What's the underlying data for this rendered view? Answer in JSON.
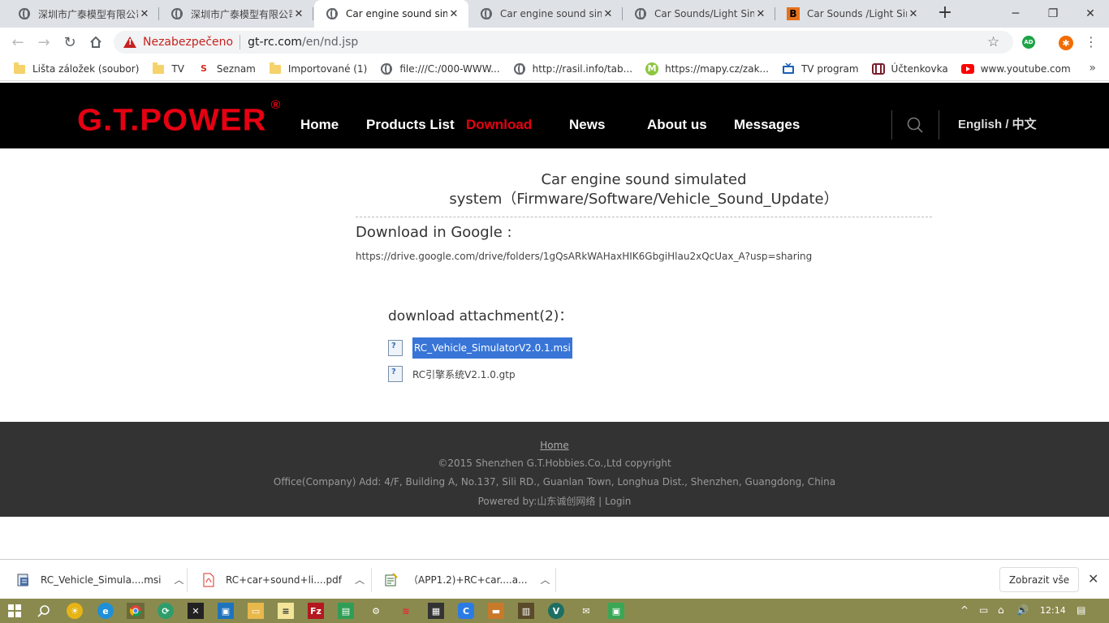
{
  "browser": {
    "tabs": [
      {
        "title": "深圳市广泰模型有限公司",
        "favicon": "globe-icon",
        "active": false
      },
      {
        "title": "深圳市广泰模型有限公司",
        "favicon": "globe-icon",
        "active": false
      },
      {
        "title": "Car engine sound simulated",
        "favicon": "globe-icon",
        "active": true
      },
      {
        "title": "Car engine sound simulated",
        "favicon": "globe-icon",
        "active": false
      },
      {
        "title": "Car Sounds/Light Simulator",
        "favicon": "globe-icon",
        "active": false
      },
      {
        "title": "Car Sounds /Light Simulator",
        "favicon": "b-icon",
        "favicon_text": "B",
        "active": false
      }
    ],
    "new_tab": "+",
    "window_controls": {
      "minimize": "─",
      "restore": "❐",
      "close": "✕"
    },
    "address": {
      "security_label": "Nezabezpečeno",
      "host": "gt-rc.com",
      "path": "/en/nd.jsp"
    },
    "extensions": {
      "ad_label": "AD",
      "avast_label": "✱"
    },
    "bookmarks": [
      {
        "label": "Lišta záložek (soubor)",
        "icon": "folder-icon"
      },
      {
        "label": "TV",
        "icon": "folder-icon"
      },
      {
        "label": "Seznam",
        "icon": "seznam-icon",
        "icon_text": "S"
      },
      {
        "label": "Importované (1)",
        "icon": "folder-icon"
      },
      {
        "label": "file:///C:/000-WWW...",
        "icon": "globe-icon"
      },
      {
        "label": "http://rasil.info/tab...",
        "icon": "globe-icon"
      },
      {
        "label": "https://mapy.cz/zak...",
        "icon": "mapy-icon",
        "icon_text": "M"
      },
      {
        "label": "TV program",
        "icon": "tv-icon"
      },
      {
        "label": "Účtenkovka",
        "icon": "uctenkovka-icon"
      },
      {
        "label": "www.youtube.com",
        "icon": "youtube-icon"
      }
    ],
    "bookmarks_more": "»"
  },
  "site": {
    "logo": "G.T.POWER",
    "logo_mark": "®",
    "nav": [
      {
        "label": "Home",
        "current": false
      },
      {
        "label": "Products List",
        "current": false
      },
      {
        "label": "Download",
        "current": true
      },
      {
        "label": "News",
        "current": false
      },
      {
        "label": "About us",
        "current": false
      },
      {
        "label": "Messages",
        "current": false
      }
    ],
    "language": "English / 中文",
    "colors": {
      "brand": "#e60012",
      "header_bg": "#000000",
      "footer_bg": "#333333",
      "selection": "#3875d7"
    }
  },
  "article": {
    "title_line1": "Car engine sound simulated",
    "title_line2": "system（Firmware/Software/Vehicle_Sound_Update）",
    "google_heading": "Download in Google :",
    "google_link": "https://drive.google.com/drive/folders/1gQsARkWAHaxHIK6GbgiHlau2xQcUax_A?usp=sharing",
    "attachments_heading": "download attachment(2)：",
    "attachments": [
      {
        "name": "RC_Vehicle_SimulatorV2.0.1.msi",
        "selected": true
      },
      {
        "name": "RC引擎系统V2.1.0.gtp",
        "selected": false
      }
    ]
  },
  "footer": {
    "home": "Home",
    "copyright": "©2015 Shenzhen G.T.Hobbies.Co.,Ltd copyright",
    "address": "Office(Company) Add: 4/F, Building A, No.137, Sili RD., Guanlan Town, Longhua Dist., Shenzhen, Guangdong, China",
    "powered": "Powered by:山东诚创网络 | Login"
  },
  "downloads": {
    "items": [
      {
        "name": "RC_Vehicle_Simula....msi",
        "icon": "msi-file-icon"
      },
      {
        "name": "RC+car+sound+li....pdf",
        "icon": "pdf-file-icon"
      },
      {
        "name": "（APP1.2)+RC+car....a...",
        "icon": "document-file-icon"
      }
    ],
    "show_all": "Zobrazit vše",
    "close": "✕"
  },
  "taskbar": {
    "clock": "12:14",
    "tray_volume": "🔊",
    "tray_arrow": "^"
  }
}
